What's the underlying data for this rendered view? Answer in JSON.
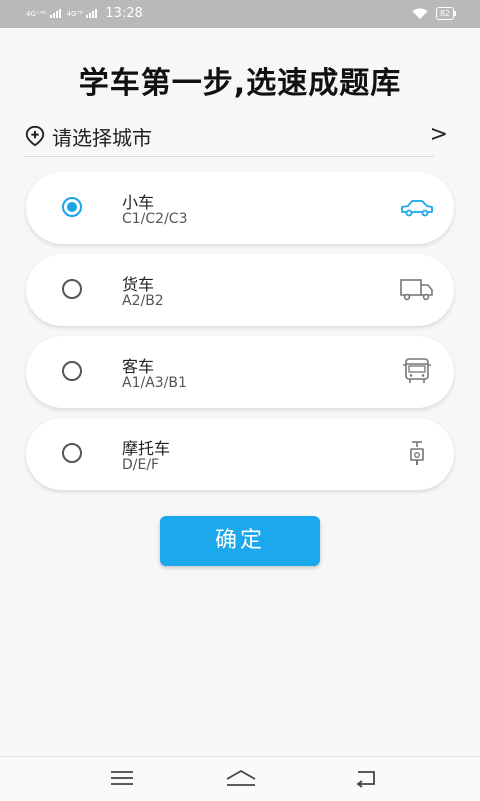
{
  "status_bar": {
    "signal_1": "4G⁺ᴴᴰ",
    "signal_2": "4Gᴴᴰ",
    "time": "13:28",
    "battery": "82"
  },
  "title": "学车第一步,选速成题库",
  "city": {
    "label": "请选择城市",
    "arrow": ">"
  },
  "vehicles": [
    {
      "name": "小车",
      "licenses": "C1/C2/C3",
      "selected": true,
      "icon": "car-icon"
    },
    {
      "name": "货车",
      "licenses": "A2/B2",
      "selected": false,
      "icon": "truck-icon"
    },
    {
      "name": "客车",
      "licenses": "A1/A3/B1",
      "selected": false,
      "icon": "bus-icon"
    },
    {
      "name": "摩托车",
      "licenses": "D/E/F",
      "selected": false,
      "icon": "scooter-icon"
    }
  ],
  "confirm_label": "确定",
  "colors": {
    "accent": "#1ba8ec",
    "background": "#f7f7f7",
    "status_bar": "#b9b9b9"
  },
  "navbar": {
    "icons": [
      "menu-icon",
      "home-icon",
      "back-icon"
    ]
  }
}
